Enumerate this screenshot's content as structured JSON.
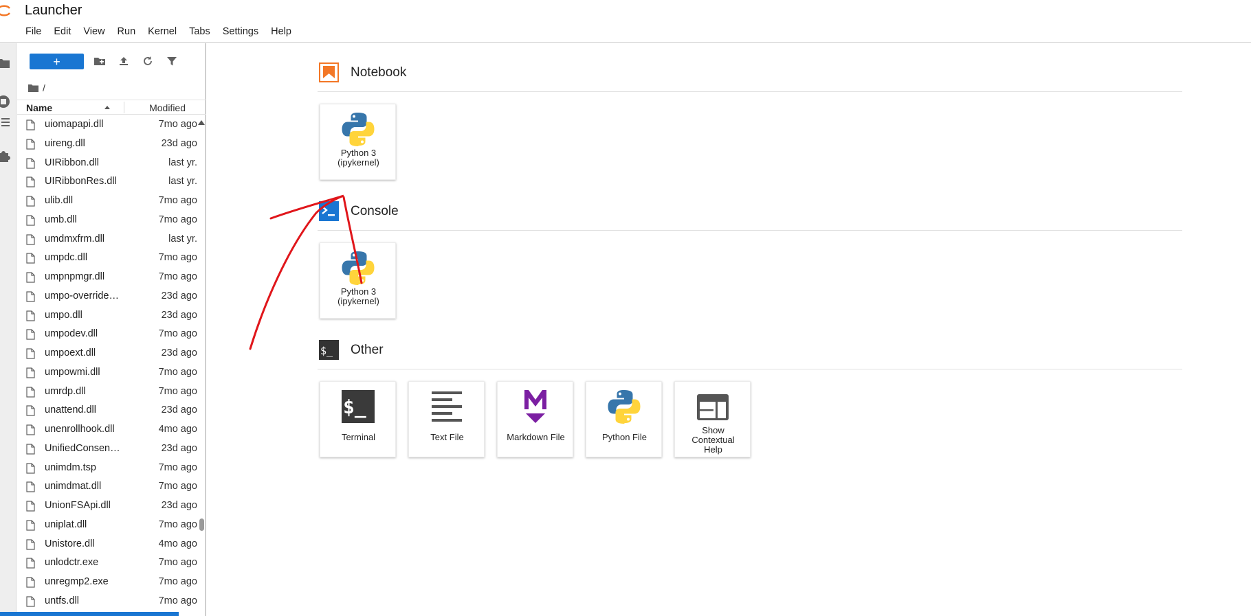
{
  "app": {
    "title": "Launcher"
  },
  "menu": [
    "File",
    "Edit",
    "View",
    "Run",
    "Kernel",
    "Tabs",
    "Settings",
    "Help"
  ],
  "file_browser": {
    "new_button_label": "+",
    "breadcrumb": "/",
    "columns": {
      "name": "Name",
      "modified": "Modified"
    },
    "files": [
      {
        "name": "uiomapapi.dll",
        "modified": "7mo ago"
      },
      {
        "name": "uireng.dll",
        "modified": "23d ago"
      },
      {
        "name": "UIRibbon.dll",
        "modified": "last yr."
      },
      {
        "name": "UIRibbonRes.dll",
        "modified": "last yr."
      },
      {
        "name": "ulib.dll",
        "modified": "7mo ago"
      },
      {
        "name": "umb.dll",
        "modified": "7mo ago"
      },
      {
        "name": "umdmxfrm.dll",
        "modified": "last yr."
      },
      {
        "name": "umpdc.dll",
        "modified": "7mo ago"
      },
      {
        "name": "umpnpmgr.dll",
        "modified": "7mo ago"
      },
      {
        "name": "umpo-override…",
        "modified": "23d ago"
      },
      {
        "name": "umpo.dll",
        "modified": "23d ago"
      },
      {
        "name": "umpodev.dll",
        "modified": "7mo ago"
      },
      {
        "name": "umpoext.dll",
        "modified": "23d ago"
      },
      {
        "name": "umpowmi.dll",
        "modified": "7mo ago"
      },
      {
        "name": "umrdp.dll",
        "modified": "7mo ago"
      },
      {
        "name": "unattend.dll",
        "modified": "23d ago"
      },
      {
        "name": "unenrollhook.dll",
        "modified": "4mo ago"
      },
      {
        "name": "UnifiedConsen…",
        "modified": "23d ago"
      },
      {
        "name": "unimdm.tsp",
        "modified": "7mo ago"
      },
      {
        "name": "unimdmat.dll",
        "modified": "7mo ago"
      },
      {
        "name": "UnionFSApi.dll",
        "modified": "23d ago"
      },
      {
        "name": "uniplat.dll",
        "modified": "7mo ago"
      },
      {
        "name": "Unistore.dll",
        "modified": "4mo ago"
      },
      {
        "name": "unlodctr.exe",
        "modified": "7mo ago"
      },
      {
        "name": "unregmp2.exe",
        "modified": "7mo ago"
      },
      {
        "name": "untfs.dll",
        "modified": "7mo ago"
      }
    ]
  },
  "launcher": {
    "sections": [
      {
        "title": "Notebook",
        "icon": "notebook-icon",
        "cards": [
          {
            "label": "Python 3\n(ipykernel)",
            "icon": "python-logo-icon"
          }
        ]
      },
      {
        "title": "Console",
        "icon": "console-icon",
        "cards": [
          {
            "label": "Python 3\n(ipykernel)",
            "icon": "python-logo-icon"
          }
        ]
      },
      {
        "title": "Other",
        "icon": "terminal-prompt-icon",
        "cards": [
          {
            "label": "Terminal",
            "icon": "terminal-icon"
          },
          {
            "label": "Text File",
            "icon": "text-file-icon"
          },
          {
            "label": "Markdown File",
            "icon": "markdown-icon"
          },
          {
            "label": "Python File",
            "icon": "python-logo-icon"
          },
          {
            "label": "Show\nContextual\nHelp",
            "icon": "contextual-help-icon"
          }
        ]
      }
    ]
  },
  "colors": {
    "accent": "#1976d2",
    "notebook": "#f37726",
    "markdown": "#7b1fa2",
    "annotation": "#e0161b"
  }
}
